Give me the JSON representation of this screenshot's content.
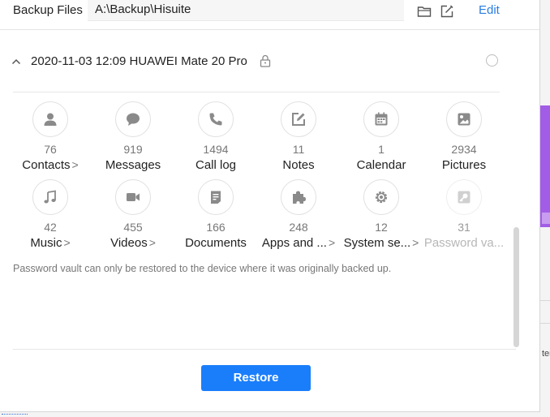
{
  "header": {
    "backup_files_label": "Backup Files",
    "path_value": "A:\\Backup\\Hisuite",
    "edit_label": "Edit"
  },
  "record": {
    "title": "2020-11-03 12:09 HUAWEI Mate 20 Pro"
  },
  "categories": [
    {
      "name": "Contacts",
      "count": "76",
      "arrow": ">",
      "icon": "person-icon"
    },
    {
      "name": "Messages",
      "count": "919",
      "arrow": "",
      "icon": "chat-bubble-icon"
    },
    {
      "name": "Call log",
      "count": "1494",
      "arrow": "",
      "icon": "phone-icon"
    },
    {
      "name": "Notes",
      "count": "11",
      "arrow": "",
      "icon": "note-edit-icon"
    },
    {
      "name": "Calendar",
      "count": "1",
      "arrow": "",
      "icon": "calendar-icon"
    },
    {
      "name": "Pictures",
      "count": "2934",
      "arrow": "",
      "icon": "image-icon"
    },
    {
      "name": "Music",
      "count": "42",
      "arrow": ">",
      "icon": "music-note-icon"
    },
    {
      "name": "Videos",
      "count": "455",
      "arrow": ">",
      "icon": "video-camera-icon"
    },
    {
      "name": "Documents",
      "count": "166",
      "arrow": "",
      "icon": "document-icon"
    },
    {
      "name": "Apps and ...",
      "count": "248",
      "arrow": ">",
      "icon": "puzzle-icon"
    },
    {
      "name": "System se...",
      "count": "12",
      "arrow": ">",
      "icon": "gear-icon"
    },
    {
      "name": "Password va...",
      "count": "31",
      "arrow": "",
      "icon": "key-icon"
    }
  ],
  "note": "Password vault can only be restored to the device where it was originally backed up.",
  "restore_label": "Restore",
  "background": {
    "partial_text": "ter"
  },
  "colors": {
    "accent": "#1a7efb",
    "icon_gray": "#8a8a8a",
    "background_purple": "#a25de6"
  }
}
